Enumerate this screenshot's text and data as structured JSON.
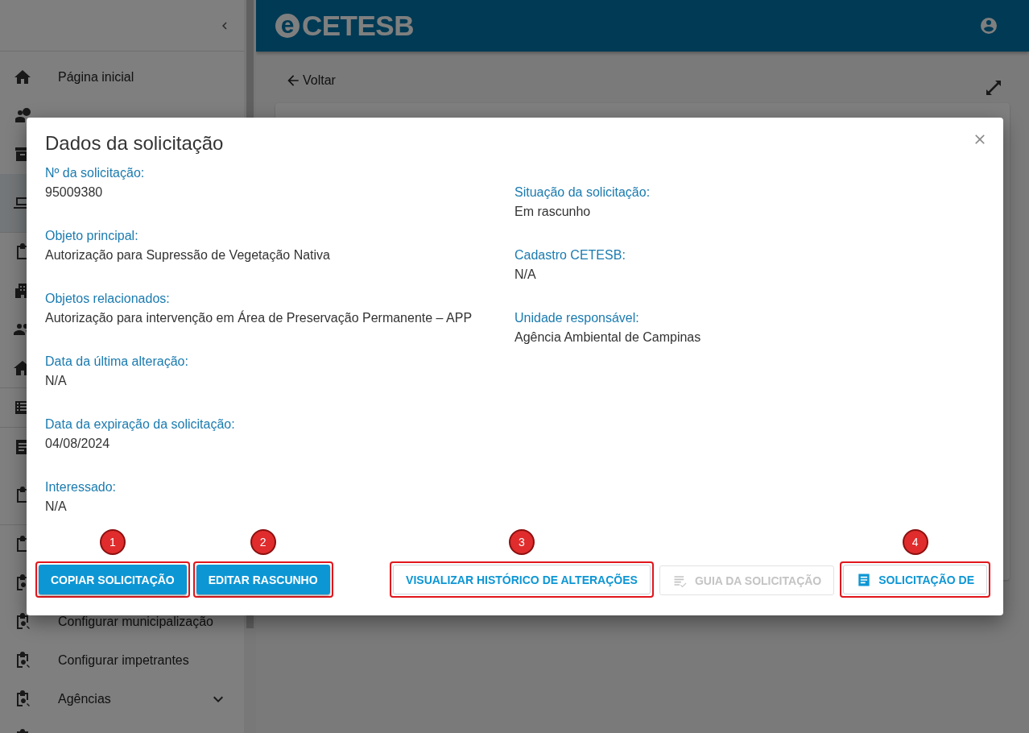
{
  "header": {
    "logo_mark": "e",
    "logo_text": "CETESB"
  },
  "sidebar": {
    "sections": [
      {
        "items": [
          {
            "label": "Página inicial",
            "selected": false
          },
          {
            "selected": false
          },
          {
            "selected": false
          },
          {
            "selected": true
          }
        ]
      },
      {
        "items": [
          {
            "selected": false
          },
          {
            "selected": false
          },
          {
            "selected": false
          },
          {
            "selected": false
          }
        ]
      },
      {
        "items": [
          {
            "selected": false
          }
        ]
      },
      {
        "items": [
          {
            "selected": false
          },
          {
            "selected": false
          }
        ]
      },
      {
        "items": [
          {
            "selected": false
          },
          {
            "selected": false
          },
          {
            "label": "Configurar municipalização",
            "selected": false
          },
          {
            "label": "Configurar impetrantes",
            "selected": false
          },
          {
            "label": "Agências",
            "selected": false,
            "expanded": false
          },
          {
            "selected": false
          }
        ]
      }
    ]
  },
  "page": {
    "back_label": "Voltar"
  },
  "dialog": {
    "title": "Dados da solicitação",
    "left_fields": [
      {
        "label": "Nº da solicitação:",
        "value": "95009380"
      },
      {
        "label": "Objeto principal:",
        "value": "Autorização para Supressão de Vegetação Nativa"
      },
      {
        "label": "Objetos relacionados:",
        "value": "Autorização para intervenção em Área de Preservação Permanente – APP"
      },
      {
        "label": "Data da última alteração:",
        "value": "N/A"
      },
      {
        "label": "Data da expiração da solicitação:",
        "value": "04/08/2024"
      },
      {
        "label": "Interessado:",
        "value": "N/A"
      }
    ],
    "right_fields": [
      {
        "label": "Situação da solicitação:",
        "value": "Em rascunho"
      },
      {
        "label": "Cadastro CETESB:",
        "value": "N/A"
      },
      {
        "label": "Unidade responsável:",
        "value": "Agência Ambiental de Campinas"
      }
    ],
    "left_buttons": [
      {
        "label": "COPIAR SOLICITAÇÃO",
        "kind": "contained",
        "disabled": false,
        "callout": "1"
      },
      {
        "label": "EDITAR RASCUNHO",
        "kind": "contained",
        "disabled": false,
        "callout": "2"
      }
    ],
    "right_buttons": [
      {
        "label": "VISUALIZAR HISTÓRICO DE ALTERAÇÕES",
        "kind": "outlined",
        "disabled": false,
        "callout": "3"
      },
      {
        "label": "GUIA DA SOLICITAÇÃO",
        "kind": "outlined-icon",
        "disabled": true
      },
      {
        "label": "SOLICITAÇÃO DE",
        "kind": "outlined-icon",
        "disabled": false,
        "callout": "4"
      }
    ]
  }
}
